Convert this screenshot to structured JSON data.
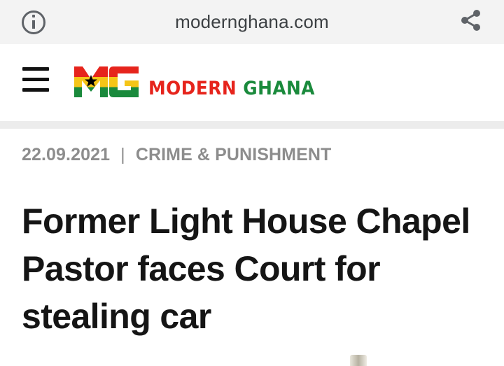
{
  "browser": {
    "url": "modernghana.com",
    "icons": [
      "info-icon",
      "share-icon"
    ]
  },
  "site": {
    "logo_mark": "MG",
    "brand_word1": "MODERN",
    "brand_word2": "GHANA",
    "menu_icon": "hamburger-menu-icon",
    "colors": {
      "red": "#e6241c",
      "yellow": "#f5c518",
      "green": "#1a8a3c",
      "star": "#000000"
    }
  },
  "article": {
    "date": "22.09.2021",
    "separator": "|",
    "category": "CRIME & PUNISHMENT",
    "headline": "Former Light House Chapel Pastor faces Court for stealing car"
  }
}
